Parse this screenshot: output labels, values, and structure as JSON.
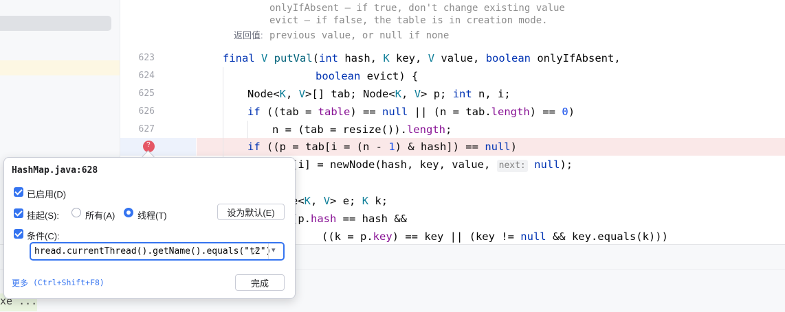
{
  "editor": {
    "doc_lines": [
      "onlyIfAbsent – if true, don't change existing value",
      "evict – if false, the table is in creation mode."
    ],
    "doc_return_label": "返回值:",
    "doc_return_text": "previous value, or null if none",
    "line_numbers": [
      "623",
      "624",
      "625",
      "626",
      "627"
    ],
    "code": {
      "l623": {
        "kw_final": "final ",
        "type_v": "V ",
        "fn": "putVal",
        "p1": "(",
        "kw_int": "int",
        "t1": " hash, ",
        "type_k": "K",
        "t2": " key, ",
        "type_v2": "V",
        "t3": " value, ",
        "kw_bool": "boolean",
        "t4": " onlyIfAbsent,"
      },
      "l624": {
        "kw_bool": "boolean",
        "t1": " evict) {"
      },
      "l625": {
        "t1": "Node<",
        "g1": "K",
        "t2": ", ",
        "g2": "V",
        "t3": ">[] tab; Node<",
        "g3": "K",
        "t4": ", ",
        "g4": "V",
        "t5": "> p; ",
        "kw_int": "int",
        "t6": " n, i;"
      },
      "l626": {
        "kw_if": "if",
        "t1": " ((tab = ",
        "f1": "table",
        "t2": ") == ",
        "kw_null": "null",
        "t3": " || (n = tab.",
        "f2": "length",
        "t4": ") == ",
        "n0": "0",
        "t5": ")"
      },
      "l627": {
        "t1": "n = (tab = resize()).",
        "f1": "length",
        "t2": ";"
      },
      "l628": {
        "kw_if": "if",
        "t1": " ((p = tab[i = (n - ",
        "n1": "1",
        "t2": ") & hash]) == ",
        "kw_null": "null",
        "t3": ")"
      },
      "l629": {
        "t1": "[i] = newNode(hash, key, value, ",
        "hint": "next:",
        "kw_null": "null",
        "t2": ");"
      },
      "l631": {
        "t1": "e<",
        "g1": "K",
        "t2": ", ",
        "g2": "V",
        "t3": "> e; ",
        "g3": "K",
        "t4": " k;"
      },
      "l632": {
        "t1": "(p.",
        "f1": "hash",
        "t2": " == hash &&"
      },
      "l633": {
        "t1": "((k = p.",
        "f1": "key",
        "t2": ") == key || (key != ",
        "kw_null": "null",
        "t3": " && key.equals(k)))"
      }
    }
  },
  "console": {
    "text": "xe ..."
  },
  "popup": {
    "title": "HashMap.java:628",
    "enabled_label": "已启用(D)",
    "suspend_label": "挂起(S):",
    "all_label": "所有(A)",
    "thread_label": "线程(T)",
    "set_default_label": "设为默认(E)",
    "condition_label": "条件(C):",
    "condition_value": "hread.currentThread().getName().equals(\"t2\")",
    "more_label": "更多",
    "more_shortcut": "(Ctrl+Shift+F8)",
    "done_label": "完成",
    "enabled": true,
    "suspend": true,
    "condition": true,
    "suspend_policy": "thread"
  }
}
